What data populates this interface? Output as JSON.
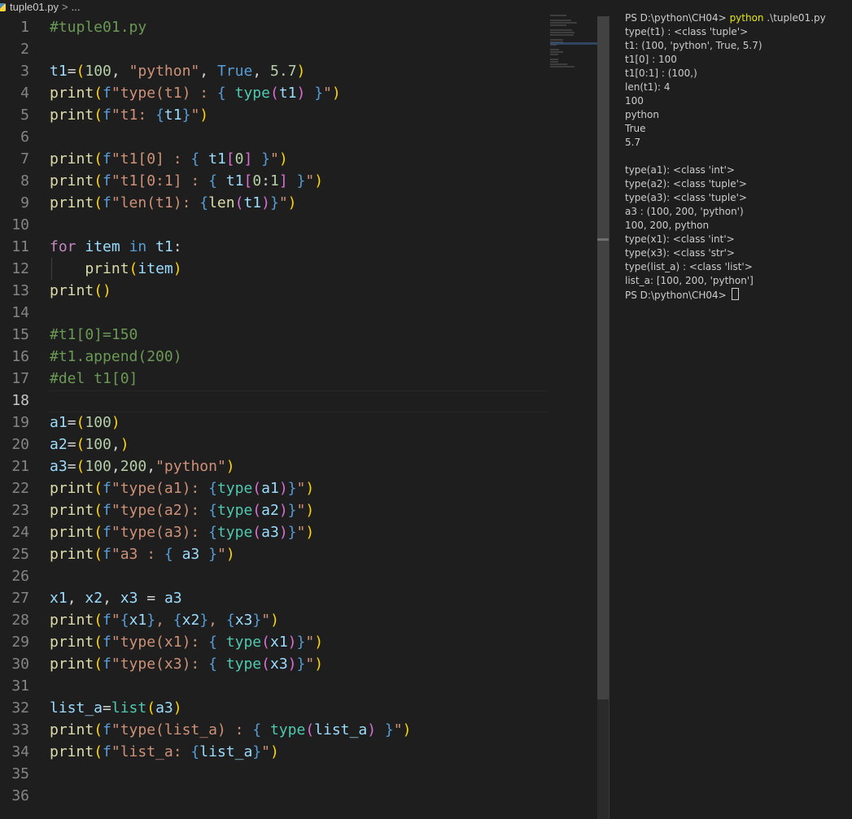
{
  "breadcrumb": {
    "file": "tuple01.py",
    "sep": ">",
    "more": "..."
  },
  "editor": {
    "active_line": "18"
  },
  "terminal": {
    "prompt": "PS D:\\python\\CH04> ",
    "command": "python",
    "command_args": " .\\tuple01.py",
    "output": [
      "type(t1) : <class 'tuple'>",
      "t1: (100, 'python', True, 5.7)",
      "t1[0] : 100",
      "t1[0:1] : (100,)",
      "len(t1): 4",
      "100",
      "python",
      "True",
      "5.7",
      "",
      "type(a1): <class 'int'>",
      "type(a2): <class 'tuple'>",
      "type(a3): <class 'tuple'>",
      "a3 : (100, 200, 'python')",
      "100, 200, python",
      "type(x1): <class 'int'>",
      "type(x3): <class 'str'>",
      "type(list_a) : <class 'list'>",
      "list_a: [100, 200, 'python']"
    ],
    "final_prompt": "PS D:\\python\\CH04> "
  },
  "code_lines": [
    {
      "n": "1",
      "t": [
        [
          "cmt",
          "#tuple01.py"
        ]
      ]
    },
    {
      "n": "2",
      "t": []
    },
    {
      "n": "3",
      "t": [
        [
          "var",
          "t1"
        ],
        [
          "op",
          "="
        ],
        [
          "b1",
          "("
        ],
        [
          "num",
          "100"
        ],
        [
          "op",
          ", "
        ],
        [
          "str",
          "\"python\""
        ],
        [
          "op",
          ", "
        ],
        [
          "bool",
          "True"
        ],
        [
          "op",
          ", "
        ],
        [
          "num",
          "5.7"
        ],
        [
          "b1",
          ")"
        ]
      ]
    },
    {
      "n": "4",
      "t": [
        [
          "fn",
          "print"
        ],
        [
          "b1",
          "("
        ],
        [
          "bool",
          "f"
        ],
        [
          "str",
          "\"type(t1) : "
        ],
        [
          "bool",
          "{"
        ],
        [
          "op",
          " "
        ],
        [
          "cls",
          "type"
        ],
        [
          "b2",
          "("
        ],
        [
          "var",
          "t1"
        ],
        [
          "b2",
          ")"
        ],
        [
          "op",
          " "
        ],
        [
          "bool",
          "}"
        ],
        [
          "str",
          "\""
        ],
        [
          "b1",
          ")"
        ]
      ]
    },
    {
      "n": "5",
      "t": [
        [
          "fn",
          "print"
        ],
        [
          "b1",
          "("
        ],
        [
          "bool",
          "f"
        ],
        [
          "str",
          "\"t1: "
        ],
        [
          "bool",
          "{"
        ],
        [
          "var",
          "t1"
        ],
        [
          "bool",
          "}"
        ],
        [
          "str",
          "\""
        ],
        [
          "b1",
          ")"
        ]
      ]
    },
    {
      "n": "6",
      "t": []
    },
    {
      "n": "7",
      "t": [
        [
          "fn",
          "print"
        ],
        [
          "b1",
          "("
        ],
        [
          "bool",
          "f"
        ],
        [
          "str",
          "\"t1[0] : "
        ],
        [
          "bool",
          "{"
        ],
        [
          "op",
          " "
        ],
        [
          "var",
          "t1"
        ],
        [
          "b2",
          "["
        ],
        [
          "num",
          "0"
        ],
        [
          "b2",
          "]"
        ],
        [
          "op",
          " "
        ],
        [
          "bool",
          "}"
        ],
        [
          "str",
          "\""
        ],
        [
          "b1",
          ")"
        ]
      ]
    },
    {
      "n": "8",
      "t": [
        [
          "fn",
          "print"
        ],
        [
          "b1",
          "("
        ],
        [
          "bool",
          "f"
        ],
        [
          "str",
          "\"t1[0:1] : "
        ],
        [
          "bool",
          "{"
        ],
        [
          "op",
          " "
        ],
        [
          "var",
          "t1"
        ],
        [
          "b2",
          "["
        ],
        [
          "num",
          "0"
        ],
        [
          "op",
          ":"
        ],
        [
          "num",
          "1"
        ],
        [
          "b2",
          "]"
        ],
        [
          "op",
          " "
        ],
        [
          "bool",
          "}"
        ],
        [
          "str",
          "\""
        ],
        [
          "b1",
          ")"
        ]
      ]
    },
    {
      "n": "9",
      "t": [
        [
          "fn",
          "print"
        ],
        [
          "b1",
          "("
        ],
        [
          "bool",
          "f"
        ],
        [
          "str",
          "\"len(t1): "
        ],
        [
          "bool",
          "{"
        ],
        [
          "fn",
          "len"
        ],
        [
          "b2",
          "("
        ],
        [
          "var",
          "t1"
        ],
        [
          "b2",
          ")"
        ],
        [
          "bool",
          "}"
        ],
        [
          "str",
          "\""
        ],
        [
          "b1",
          ")"
        ]
      ]
    },
    {
      "n": "10",
      "t": []
    },
    {
      "n": "11",
      "t": [
        [
          "kw",
          "for"
        ],
        [
          "op",
          " "
        ],
        [
          "var",
          "item"
        ],
        [
          "op",
          " "
        ],
        [
          "bool",
          "in"
        ],
        [
          "op",
          " "
        ],
        [
          "var",
          "t1"
        ],
        [
          "op",
          ":"
        ]
      ]
    },
    {
      "n": "12",
      "t": [
        [
          "op",
          "    "
        ],
        [
          "fn",
          "print"
        ],
        [
          "b1",
          "("
        ],
        [
          "var",
          "item"
        ],
        [
          "b1",
          ")"
        ]
      ]
    },
    {
      "n": "13",
      "t": [
        [
          "fn",
          "print"
        ],
        [
          "b1",
          "()"
        ]
      ]
    },
    {
      "n": "14",
      "t": []
    },
    {
      "n": "15",
      "t": [
        [
          "cmt",
          "#t1[0]=150"
        ]
      ]
    },
    {
      "n": "16",
      "t": [
        [
          "cmt",
          "#t1.append(200)"
        ]
      ]
    },
    {
      "n": "17",
      "t": [
        [
          "cmt",
          "#del t1[0]"
        ]
      ]
    },
    {
      "n": "18",
      "t": []
    },
    {
      "n": "19",
      "t": [
        [
          "var",
          "a1"
        ],
        [
          "op",
          "="
        ],
        [
          "b1",
          "("
        ],
        [
          "num",
          "100"
        ],
        [
          "b1",
          ")"
        ]
      ]
    },
    {
      "n": "20",
      "t": [
        [
          "var",
          "a2"
        ],
        [
          "op",
          "="
        ],
        [
          "b1",
          "("
        ],
        [
          "num",
          "100"
        ],
        [
          "op",
          ","
        ],
        [
          "b1",
          ")"
        ]
      ]
    },
    {
      "n": "21",
      "t": [
        [
          "var",
          "a3"
        ],
        [
          "op",
          "="
        ],
        [
          "b1",
          "("
        ],
        [
          "num",
          "100"
        ],
        [
          "op",
          ","
        ],
        [
          "num",
          "200"
        ],
        [
          "op",
          ","
        ],
        [
          "str",
          "\"python\""
        ],
        [
          "b1",
          ")"
        ]
      ]
    },
    {
      "n": "22",
      "t": [
        [
          "fn",
          "print"
        ],
        [
          "b1",
          "("
        ],
        [
          "bool",
          "f"
        ],
        [
          "str",
          "\"type(a1): "
        ],
        [
          "bool",
          "{"
        ],
        [
          "cls",
          "type"
        ],
        [
          "b2",
          "("
        ],
        [
          "var",
          "a1"
        ],
        [
          "b2",
          ")"
        ],
        [
          "bool",
          "}"
        ],
        [
          "str",
          "\""
        ],
        [
          "b1",
          ")"
        ]
      ]
    },
    {
      "n": "23",
      "t": [
        [
          "fn",
          "print"
        ],
        [
          "b1",
          "("
        ],
        [
          "bool",
          "f"
        ],
        [
          "str",
          "\"type(a2): "
        ],
        [
          "bool",
          "{"
        ],
        [
          "cls",
          "type"
        ],
        [
          "b2",
          "("
        ],
        [
          "var",
          "a2"
        ],
        [
          "b2",
          ")"
        ],
        [
          "bool",
          "}"
        ],
        [
          "str",
          "\""
        ],
        [
          "b1",
          ")"
        ]
      ]
    },
    {
      "n": "24",
      "t": [
        [
          "fn",
          "print"
        ],
        [
          "b1",
          "("
        ],
        [
          "bool",
          "f"
        ],
        [
          "str",
          "\"type(a3): "
        ],
        [
          "bool",
          "{"
        ],
        [
          "cls",
          "type"
        ],
        [
          "b2",
          "("
        ],
        [
          "var",
          "a3"
        ],
        [
          "b2",
          ")"
        ],
        [
          "bool",
          "}"
        ],
        [
          "str",
          "\""
        ],
        [
          "b1",
          ")"
        ]
      ]
    },
    {
      "n": "25",
      "t": [
        [
          "fn",
          "print"
        ],
        [
          "b1",
          "("
        ],
        [
          "bool",
          "f"
        ],
        [
          "str",
          "\"a3 : "
        ],
        [
          "bool",
          "{"
        ],
        [
          "op",
          " "
        ],
        [
          "var",
          "a3"
        ],
        [
          "op",
          " "
        ],
        [
          "bool",
          "}"
        ],
        [
          "str",
          "\""
        ],
        [
          "b1",
          ")"
        ]
      ]
    },
    {
      "n": "26",
      "t": []
    },
    {
      "n": "27",
      "t": [
        [
          "var",
          "x1"
        ],
        [
          "op",
          ", "
        ],
        [
          "var",
          "x2"
        ],
        [
          "op",
          ", "
        ],
        [
          "var",
          "x3"
        ],
        [
          "op",
          " = "
        ],
        [
          "var",
          "a3"
        ]
      ]
    },
    {
      "n": "28",
      "t": [
        [
          "fn",
          "print"
        ],
        [
          "b1",
          "("
        ],
        [
          "bool",
          "f"
        ],
        [
          "str",
          "\""
        ],
        [
          "bool",
          "{"
        ],
        [
          "var",
          "x1"
        ],
        [
          "bool",
          "}"
        ],
        [
          "str",
          ", "
        ],
        [
          "bool",
          "{"
        ],
        [
          "var",
          "x2"
        ],
        [
          "bool",
          "}"
        ],
        [
          "str",
          ", "
        ],
        [
          "bool",
          "{"
        ],
        [
          "var",
          "x3"
        ],
        [
          "bool",
          "}"
        ],
        [
          "str",
          "\""
        ],
        [
          "b1",
          ")"
        ]
      ]
    },
    {
      "n": "29",
      "t": [
        [
          "fn",
          "print"
        ],
        [
          "b1",
          "("
        ],
        [
          "bool",
          "f"
        ],
        [
          "str",
          "\"type(x1): "
        ],
        [
          "bool",
          "{"
        ],
        [
          "op",
          " "
        ],
        [
          "cls",
          "type"
        ],
        [
          "b2",
          "("
        ],
        [
          "var",
          "x1"
        ],
        [
          "b2",
          ")"
        ],
        [
          "bool",
          "}"
        ],
        [
          "str",
          "\""
        ],
        [
          "b1",
          ")"
        ]
      ]
    },
    {
      "n": "30",
      "t": [
        [
          "fn",
          "print"
        ],
        [
          "b1",
          "("
        ],
        [
          "bool",
          "f"
        ],
        [
          "str",
          "\"type(x3): "
        ],
        [
          "bool",
          "{"
        ],
        [
          "op",
          " "
        ],
        [
          "cls",
          "type"
        ],
        [
          "b2",
          "("
        ],
        [
          "var",
          "x3"
        ],
        [
          "b2",
          ")"
        ],
        [
          "bool",
          "}"
        ],
        [
          "str",
          "\""
        ],
        [
          "b1",
          ")"
        ]
      ]
    },
    {
      "n": "31",
      "t": []
    },
    {
      "n": "32",
      "t": [
        [
          "var",
          "list_a"
        ],
        [
          "op",
          "="
        ],
        [
          "cls",
          "list"
        ],
        [
          "b1",
          "("
        ],
        [
          "var",
          "a3"
        ],
        [
          "b1",
          ")"
        ]
      ]
    },
    {
      "n": "33",
      "t": [
        [
          "fn",
          "print"
        ],
        [
          "b1",
          "("
        ],
        [
          "bool",
          "f"
        ],
        [
          "str",
          "\"type(list_a) : "
        ],
        [
          "bool",
          "{"
        ],
        [
          "op",
          " "
        ],
        [
          "cls",
          "type"
        ],
        [
          "b2",
          "("
        ],
        [
          "var",
          "list_a"
        ],
        [
          "b2",
          ")"
        ],
        [
          "op",
          " "
        ],
        [
          "bool",
          "}"
        ],
        [
          "str",
          "\""
        ],
        [
          "b1",
          ")"
        ]
      ]
    },
    {
      "n": "34",
      "t": [
        [
          "fn",
          "print"
        ],
        [
          "b1",
          "("
        ],
        [
          "bool",
          "f"
        ],
        [
          "str",
          "\"list_a: "
        ],
        [
          "bool",
          "{"
        ],
        [
          "var",
          "list_a"
        ],
        [
          "bool",
          "}"
        ],
        [
          "str",
          "\""
        ],
        [
          "b1",
          ")"
        ]
      ]
    },
    {
      "n": "35",
      "t": []
    },
    {
      "n": "36",
      "t": []
    }
  ]
}
